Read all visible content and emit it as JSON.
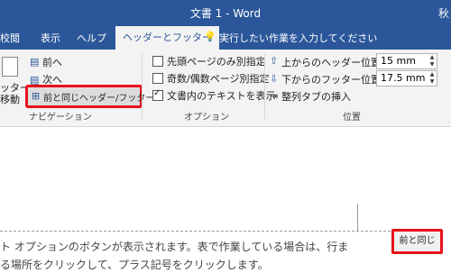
{
  "window": {
    "title": "文書 1  -  Word",
    "user": "秋"
  },
  "tabs": [
    "校閲",
    "表示",
    "ヘルプ",
    "ヘッダーとフッター"
  ],
  "tell_me": "実行したい作業を入力してください",
  "navigation": {
    "left_partial_top": "ッター",
    "left_partial_suffix": "に",
    "left_partial_bottom": "移動",
    "prev": "前へ",
    "next": "次へ",
    "link_previous": "前と同じヘッダー/フッター",
    "group_label": "ナビゲーション"
  },
  "options": {
    "diff_first": "先頭ページのみ別指定",
    "diff_odd_even": "奇数/偶数ページ別指定",
    "show_doc_text": "文書内のテキストを表示",
    "group_label": "オプション",
    "checked": {
      "diff_first": false,
      "diff_odd_even": false,
      "show_doc_text": true
    }
  },
  "position": {
    "header_label": "上からのヘッダー位置:",
    "header_value": "15 mm",
    "footer_label": "下からのフッター位置:",
    "footer_value": "17.5 mm",
    "align_tab": "整列タブの挿入",
    "group_label": "位置"
  },
  "document": {
    "line1": "ト オプションのボタンが表示されます。表で作業している場合は、行ま",
    "line2": "る場所をクリックして、プラス記号をクリックします。",
    "same_as_previous": "前と同じ"
  },
  "colors": {
    "brand": "#2b579a",
    "highlight": "#e8121a"
  }
}
